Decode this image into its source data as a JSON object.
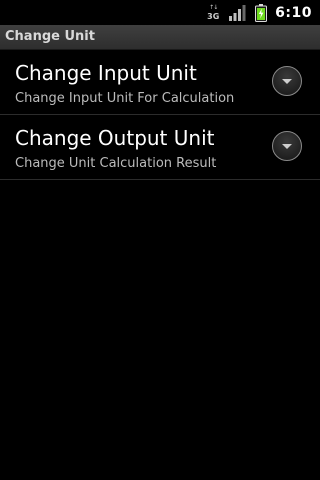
{
  "status_bar": {
    "network_type": "3G",
    "network_arrows": "↑↓",
    "time": "6:10",
    "signal_icon": "signal-bars-icon",
    "battery_icon": "battery-charging-icon",
    "battery_color": "#6fdc1f"
  },
  "title_bar": {
    "title": "Change Unit"
  },
  "preferences": [
    {
      "title": "Change Input Unit",
      "summary": "Change Input Unit For Calculation",
      "icon": "chevron-down-icon"
    },
    {
      "title": "Change Output Unit",
      "summary": "Change Unit Calculation Result",
      "icon": "chevron-down-icon"
    }
  ]
}
